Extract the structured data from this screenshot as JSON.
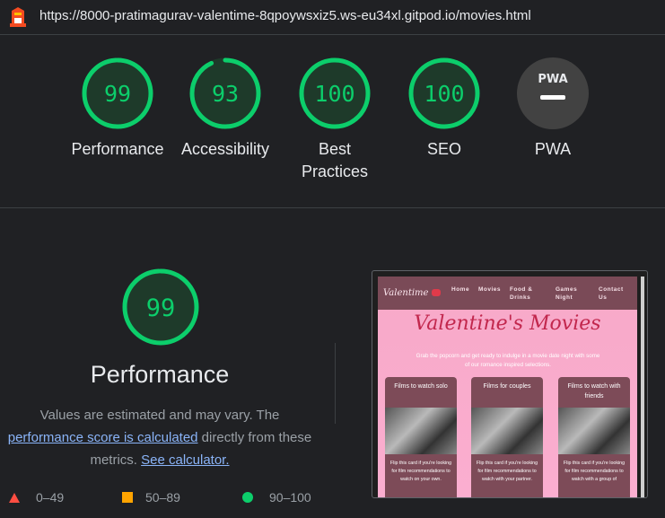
{
  "url": "https://8000-pratimagurav-valentime-8qpoywsxiz5.ws-eu34xl.gitpod.io/movies.html",
  "colors": {
    "pass": "#0cce6b",
    "average": "#ffa400",
    "fail": "#ff4e42",
    "link": "#8ab4f8"
  },
  "gauges": [
    {
      "score": "99",
      "label": "Performance",
      "fraction": 0.99
    },
    {
      "score": "93",
      "label": "Accessibility",
      "fraction": 0.93
    },
    {
      "score": "100",
      "label": "Best Practices",
      "fraction": 1.0
    },
    {
      "score": "100",
      "label": "SEO",
      "fraction": 1.0
    },
    {
      "badge": "PWA",
      "label": "PWA"
    }
  ],
  "performance": {
    "score": "99",
    "fraction": 0.99,
    "title": "Performance",
    "desc_part1": "Values are estimated and may vary. The",
    "link1": "performance score is calculated",
    "desc_part2": " directly from these metrics. ",
    "link2": "See calculator."
  },
  "legend": [
    {
      "range": "0–49",
      "shape": "triangle"
    },
    {
      "range": "50–89",
      "shape": "square"
    },
    {
      "range": "90–100",
      "shape": "circle"
    }
  ],
  "preview": {
    "brand": "Valentime",
    "nav": [
      "Home",
      "Movies",
      "Food & Drinks",
      "Games Night",
      "Contact Us"
    ],
    "title": "Valentine's Movies",
    "subtitle": "Grab the popcorn and get ready to indulge in a movie date night with some of our romance inspired selections.",
    "cards": [
      {
        "title": "Films to watch solo",
        "text": "Flip this card if you're looking for film recommendations to watch on your own."
      },
      {
        "title": "Films for couples",
        "text": "Flip this card if you're looking for film recommendations to watch with your partner."
      },
      {
        "title": "Films to watch with friends",
        "text": "Flip this card if you're looking for film recommendations to watch with a group of"
      }
    ]
  }
}
